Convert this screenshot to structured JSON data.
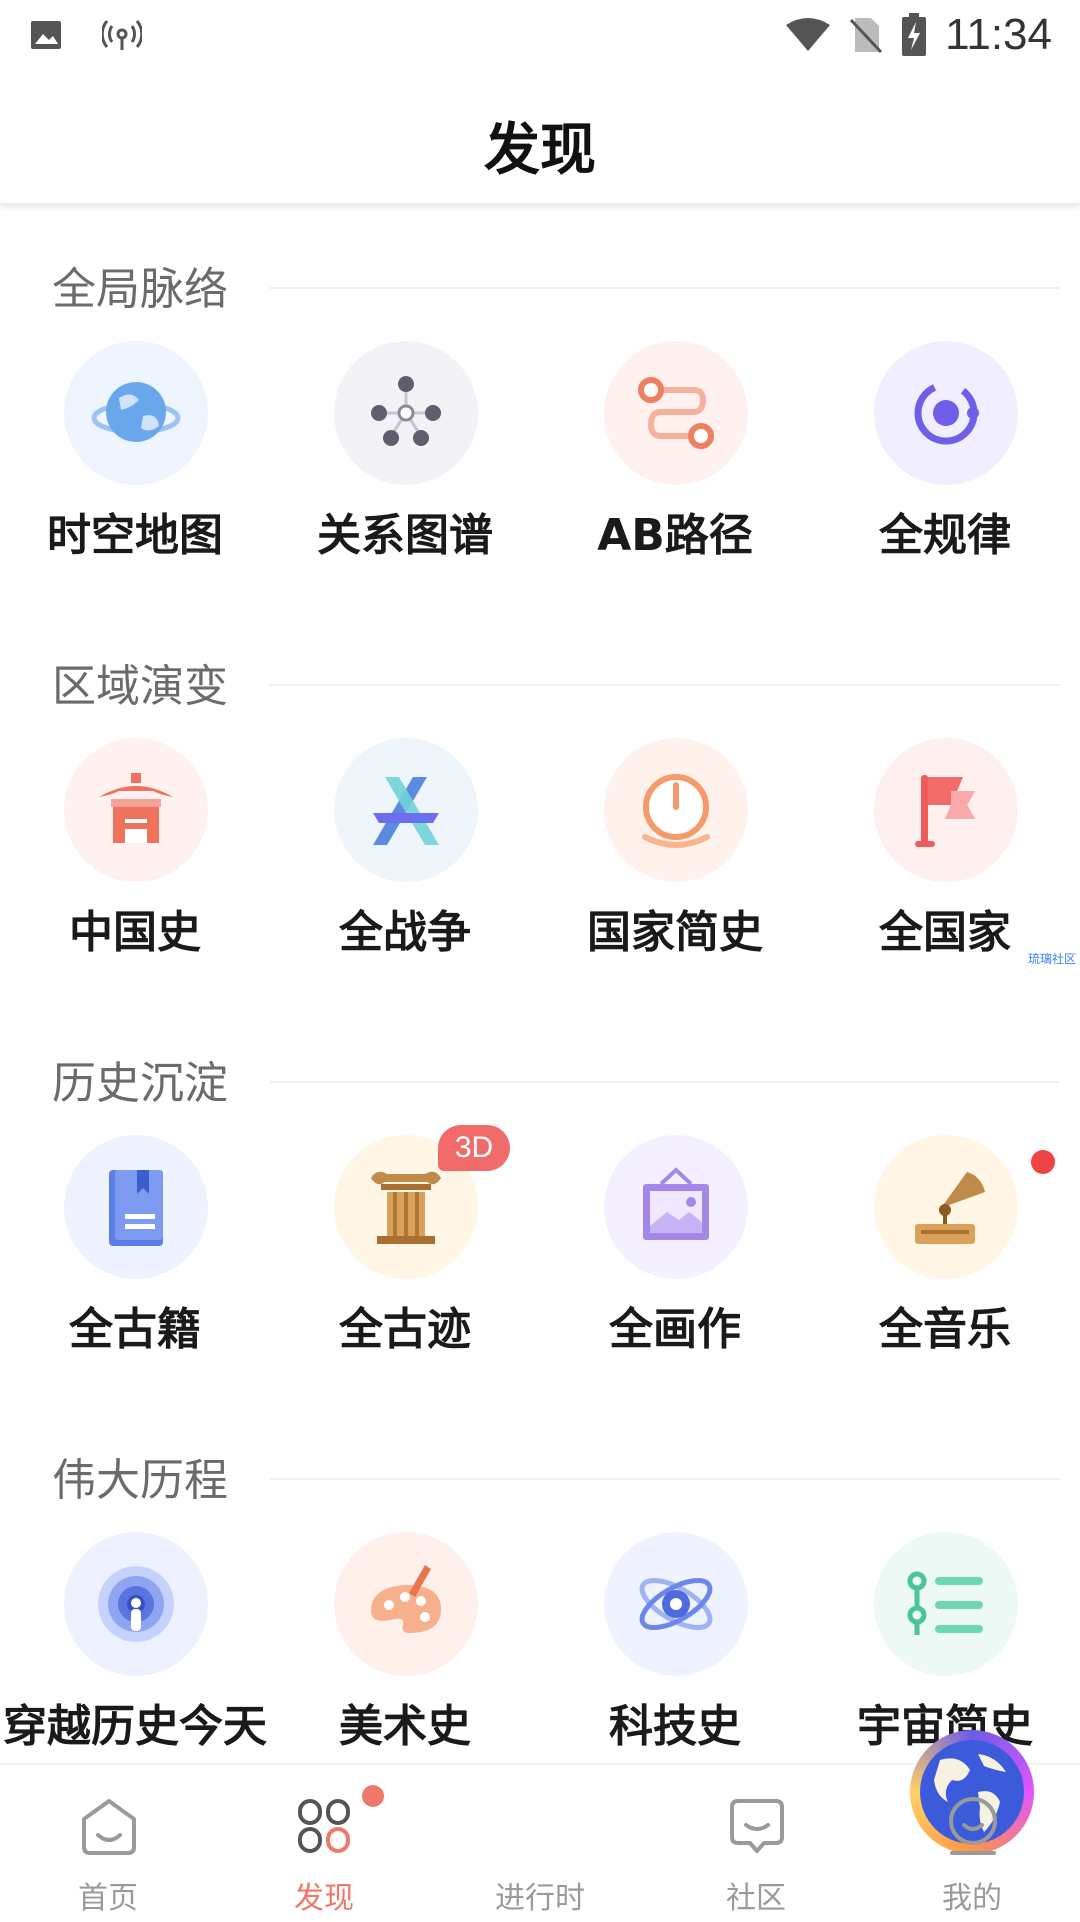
{
  "status_bar": {
    "time": "11:34",
    "icons": [
      "image-icon",
      "hotspot-icon",
      "wifi-icon",
      "no-sim-icon",
      "battery-charging-icon"
    ]
  },
  "header": {
    "title": "发现"
  },
  "sections": [
    {
      "title": "全局脉络",
      "items": [
        {
          "label": "时空地图",
          "icon": "globe-icon",
          "bg": "#eef5ff"
        },
        {
          "label": "关系图谱",
          "icon": "graph-nodes-icon",
          "bg": "#f2f2f7"
        },
        {
          "label": "AB路径",
          "icon": "path-icon",
          "bg": "#fff1ed"
        },
        {
          "label": "全规律",
          "icon": "orbit-icon",
          "bg": "#f1efff"
        }
      ]
    },
    {
      "title": "区域演变",
      "items": [
        {
          "label": "中国史",
          "icon": "pavilion-icon",
          "bg": "#fff1ef"
        },
        {
          "label": "全战争",
          "icon": "crossed-swords-icon",
          "bg": "#eef6fb"
        },
        {
          "label": "国家简史",
          "icon": "gauge-icon",
          "bg": "#fff2ec"
        },
        {
          "label": "全国家",
          "icon": "flag-icon",
          "bg": "#fff0f0"
        }
      ]
    },
    {
      "title": "历史沉淀",
      "items": [
        {
          "label": "全古籍",
          "icon": "book-icon",
          "bg": "#eff3ff"
        },
        {
          "label": "全古迹",
          "icon": "column-icon",
          "bg": "#fff6e6",
          "badge": "3D"
        },
        {
          "label": "全画作",
          "icon": "painting-frame-icon",
          "bg": "#f5f0ff"
        },
        {
          "label": "全音乐",
          "icon": "gramophone-icon",
          "bg": "#fff6e6",
          "dot": true
        }
      ]
    },
    {
      "title": "伟大历程",
      "items": [
        {
          "label": "穿越历史今天",
          "icon": "vortex-icon",
          "bg": "#eef2ff"
        },
        {
          "label": "美术史",
          "icon": "palette-icon",
          "bg": "#fff0ec"
        },
        {
          "label": "科技史",
          "icon": "atom-icon",
          "bg": "#eef3ff"
        },
        {
          "label": "宇宙简史",
          "icon": "list-icon",
          "bg": "#ecf9f5"
        }
      ]
    }
  ],
  "watermark": "琉璃社区",
  "tabbar": {
    "tabs": [
      {
        "label": "首页",
        "icon": "home-icon"
      },
      {
        "label": "发现",
        "icon": "discover-icon",
        "active": true
      },
      {
        "label": "进行时",
        "icon": "globe-center-icon"
      },
      {
        "label": "社区",
        "icon": "chat-icon"
      },
      {
        "label": "我的",
        "icon": "profile-icon"
      }
    ]
  },
  "colors": {
    "accent": "#f0786a",
    "badge": "#f26b6b"
  }
}
